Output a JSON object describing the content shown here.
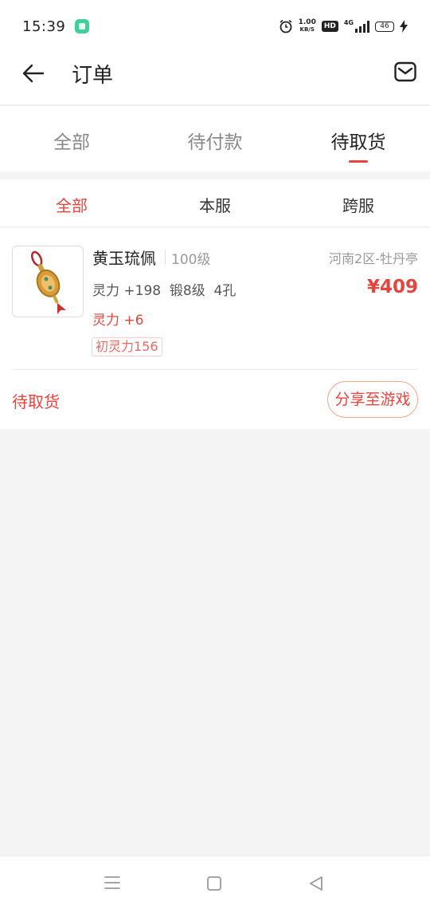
{
  "status_bar": {
    "time": "15:39",
    "net_speed_value": "1.00",
    "net_speed_unit": "KB/S",
    "hd": "HD",
    "network": "4G",
    "battery": "46"
  },
  "header": {
    "title": "订单"
  },
  "main_tabs": [
    {
      "label": "全部",
      "active": false
    },
    {
      "label": "待付款",
      "active": false
    },
    {
      "label": "待取货",
      "active": true
    }
  ],
  "sub_tabs": [
    {
      "label": "全部",
      "active": true
    },
    {
      "label": "本服",
      "active": false
    },
    {
      "label": "跨服",
      "active": false
    }
  ],
  "order": {
    "item_name": "黄玉琉佩",
    "level": "100级",
    "server": "河南2区-牡丹亭",
    "stats": "灵力 +198  锻8级  4孔",
    "price": "¥409",
    "bonus": "灵力 +6",
    "tag": "初灵力156",
    "status": "待取货",
    "share_label": "分享至游戏"
  },
  "colors": {
    "accent": "#e5453d",
    "background": "#f4f4f4"
  },
  "icons": {
    "back": "back-arrow-icon",
    "mail": "mail-icon",
    "nav_menu": "menu-icon",
    "nav_home": "home-icon",
    "nav_back": "back-triangle-icon"
  }
}
